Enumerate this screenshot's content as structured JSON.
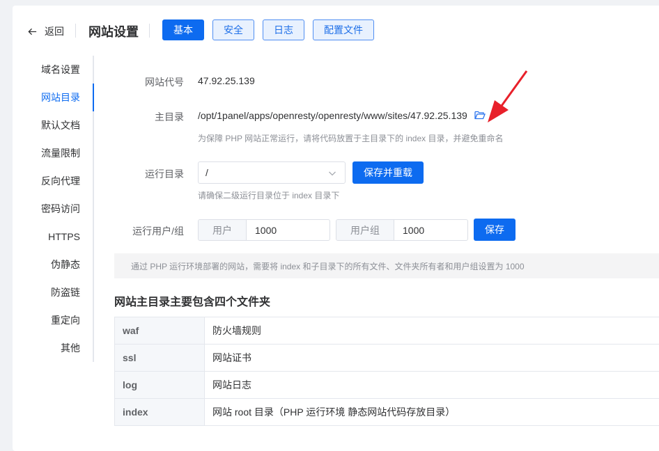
{
  "header": {
    "back_label": "返回",
    "title": "网站设置",
    "tabs": [
      {
        "label": "基本",
        "active": true
      },
      {
        "label": "安全",
        "active": false
      },
      {
        "label": "日志",
        "active": false
      },
      {
        "label": "配置文件",
        "active": false
      }
    ]
  },
  "sidebar": {
    "items": [
      {
        "label": "域名设置"
      },
      {
        "label": "网站目录",
        "active": true
      },
      {
        "label": "默认文档"
      },
      {
        "label": "流量限制"
      },
      {
        "label": "反向代理"
      },
      {
        "label": "密码访问"
      },
      {
        "label": "HTTPS"
      },
      {
        "label": "伪静态"
      },
      {
        "label": "防盗链"
      },
      {
        "label": "重定向"
      },
      {
        "label": "其他"
      }
    ]
  },
  "form": {
    "site_code_label": "网站代号",
    "site_code_value": "47.92.25.139",
    "main_dir_label": "主目录",
    "main_dir_value": "/opt/1panel/apps/openresty/openresty/www/sites/47.92.25.139",
    "main_dir_hint": "为保障 PHP 网站正常运行，请将代码放置于主目录下的 index 目录，并避免重命名",
    "run_dir_label": "运行目录",
    "run_dir_value": "/",
    "save_reload_label": "保存并重载",
    "run_dir_hint": "请确保二级运行目录位于 index 目录下",
    "run_user_label": "运行用户/组",
    "user_prefix": "用户",
    "user_value": "1000",
    "group_prefix": "用户组",
    "group_value": "1000",
    "save_label": "保存"
  },
  "notice": "通过 PHP 运行环境部署的网站，需要将 index 和子目录下的所有文件、文件夹所有者和用户组设置为 1000",
  "folders": {
    "title": "网站主目录主要包含四个文件夹",
    "rows": [
      {
        "key": "waf",
        "desc": "防火墙规则"
      },
      {
        "key": "ssl",
        "desc": "网站证书"
      },
      {
        "key": "log",
        "desc": "网站日志"
      },
      {
        "key": "index",
        "desc": "网站 root 目录（PHP 运行环境 静态网站代码存放目录）"
      }
    ]
  },
  "colors": {
    "primary": "#0d6bf0",
    "annotation_arrow": "#e8202a"
  },
  "icons": [
    "arrow-left-icon",
    "folder-open-icon",
    "chevron-down-icon",
    "red-pointer-arrow-icon"
  ]
}
